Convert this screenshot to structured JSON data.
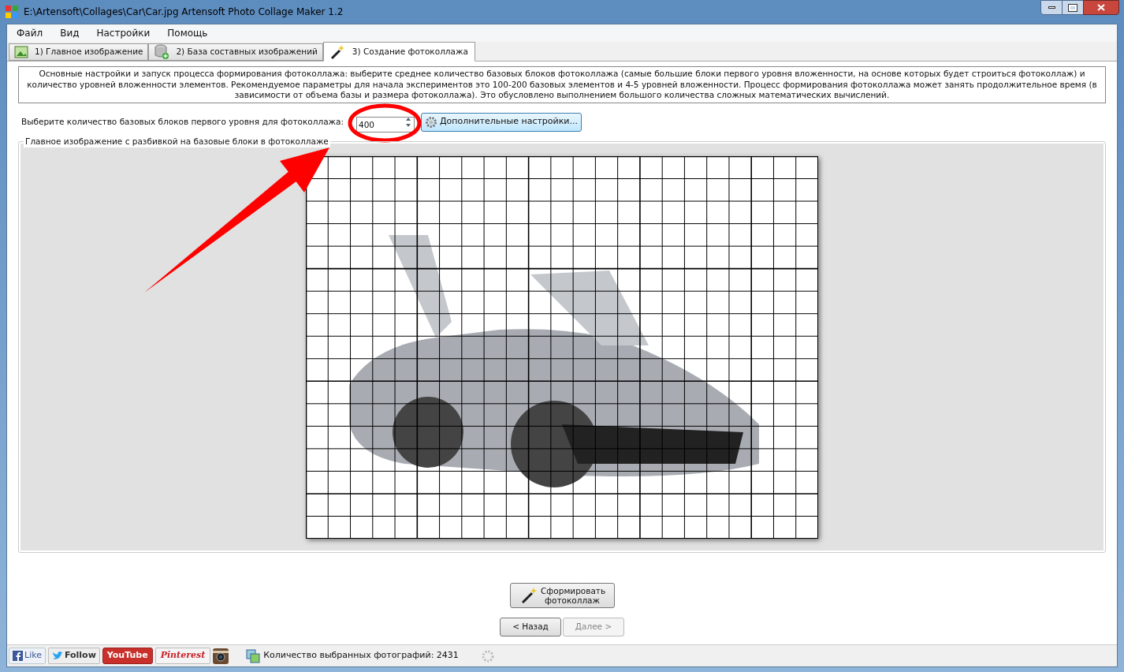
{
  "window": {
    "title": "E:\\Artensoft\\Collages\\Car\\Car.jpg Artensoft Photo Collage Maker 1.2"
  },
  "menu": [
    "Файл",
    "Вид",
    "Настройки",
    "Помощь"
  ],
  "tabs": [
    {
      "label": "1) Главное изображение",
      "selected": false,
      "kind": "picture"
    },
    {
      "label": "2) База составных изображений",
      "selected": false,
      "kind": "database"
    },
    {
      "label": "3) Создание фотоколлажа",
      "selected": true,
      "kind": "wand"
    }
  ],
  "description": "Основные настройки и запуск процесса формирования фотоколлажа: выберите среднее количество базовых блоков фотоколлажа (самые большие блоки первого уровня вложенности, на основе которых будет строиться фотоколлаж) и количество уровней вложенности элементов. Рекомендуемое параметры для начала экспериментов это 100-200 базовых элементов и 4-5 уровней вложенности.  Процесс формирования фотоколлажа может занять продолжительное время (в зависимости от объема базы и размера фотоколлажа). Это обусловлено выполнением большого количества сложных математических вычислений.",
  "blocks_setting": {
    "label": "Выберите количество базовых блоков первого уровня для фотоколлажа:",
    "value": "400"
  },
  "advanced_button": "Дополнительные настройки...",
  "preview_group": {
    "title": "Главное изображение с разбивкой на базовые блоки в фотоколлаже"
  },
  "generate_button": "Сформировать фотоколлаж",
  "nav_buttons": [
    {
      "label": "< Назад",
      "disabled": false
    },
    {
      "label": "Далее >",
      "disabled": true
    }
  ],
  "social_buttons": [
    {
      "kind": "facebook",
      "label": "Like"
    },
    {
      "kind": "twitter",
      "label": "Follow"
    },
    {
      "kind": "youtube",
      "label": "YouTube"
    },
    {
      "kind": "pinterest",
      "label": "Pinterest"
    },
    {
      "kind": "instagram"
    }
  ],
  "status": {
    "text": "Количество выбранных фотографий: 2431"
  }
}
